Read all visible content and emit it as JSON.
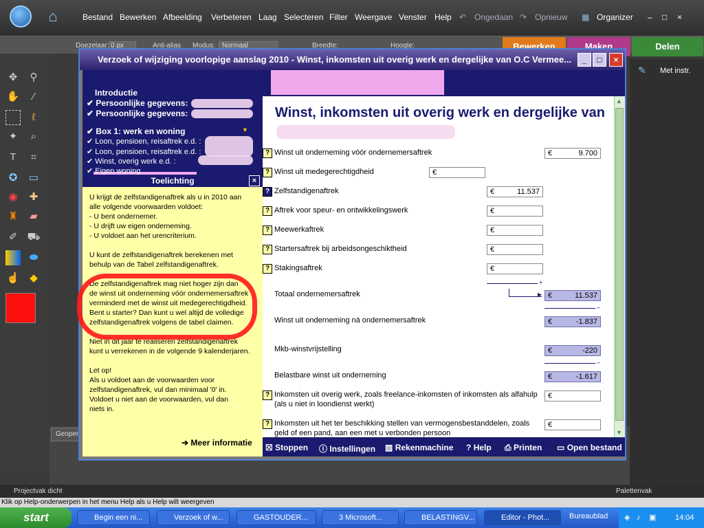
{
  "ps": {
    "menu": [
      "Bestand",
      "Bewerken",
      "Afbeelding",
      "Verbeteren",
      "Laag",
      "Selecteren",
      "Filter",
      "Weergave",
      "Venster",
      "Help"
    ],
    "undo": "Ongedaan",
    "redo": "Opnieuw",
    "organizer": "Organizer",
    "opt_doezelaar": "Doezelaar:",
    "opt_doezel_val": "0 px",
    "opt_antialias": "Anti-alias",
    "opt_modus": "Modus:",
    "opt_modus_val": "Normaal",
    "opt_breedte": "Breedte:",
    "opt_hoogte": "Hoogte:",
    "tab_bewerken": "Bewerken",
    "tab_maken": "Maken",
    "tab_delen": "Delen",
    "met_instr": "Met instr.",
    "geopend": "Geopen",
    "projectvak": "Projectvak dicht",
    "palettenvak": "Palettenvak",
    "helpline": "Klik op Help-onderwerpen in het menu Help als u Help wilt weergeven",
    "fg_color": "#ff1010"
  },
  "dialog": {
    "title": "Verzoek of wijziging voorlopige aanslag 2010 - Winst, inkomsten uit overig werk en dergelijke van O.C Vermee...",
    "nav": {
      "introductie": "Introductie",
      "pg1": "Persoonlijke gegevens:",
      "pg2": "Persoonlijke gegevens:",
      "box1": "Box 1: werk en woning",
      "loon1": "Loon, pensioen, reisaftrek e.d. :",
      "loon2": "Loon, pensioen, reisaftrek e.d. :",
      "winst": "Winst, overig werk e.d. :",
      "eigen": "Eigen woning"
    },
    "toelichting": {
      "header": "Toelichting",
      "p1": [
        "U krijgt de zelfstandigenaftrek als u in 2010 aan",
        "alle volgende voorwaarden voldoet:",
        "- U bent ondernemer.",
        "- U drijft uw eigen onderneming.",
        "- U voldoet aan het urencriterium."
      ],
      "p2": [
        "U kunt de zelfstandigenaftrek berekenen met",
        "behulp van de Tabel zelfstandigenaftrek."
      ],
      "p3": [
        "De zelfstandigenaftrek mag niet hoger zijn dan",
        "de winst uit onderneming vóór ondernemersaftrek",
        "verminderd met de winst uit medegerechtigdheid.",
        "Bent u starter? Dan kunt u wel altijd de volledige",
        "zelfstandigenaftrek volgens de tabel claimen."
      ],
      "p4": [
        "Niet in dit jaar te realiseren zelfstandigenaftrek",
        "kunt u verrekenen in de volgende 9 kalenderjaren."
      ],
      "p5": [
        "Let op!",
        "Als u voldoet aan de voorwaarden voor",
        "zelfstandigenaftrek, vul dan minimaal '0' in.",
        "Voldoet u niet aan de voorwaarden, vul dan",
        "niets in."
      ],
      "meer": "Meer informatie"
    },
    "form": {
      "title": "Winst, inkomsten uit overig werk en dergelijke van",
      "currency": "€",
      "rows": [
        {
          "label": "Winst uit onderneming vóór ondernemersaftrek",
          "value": "9.700"
        },
        {
          "label": "Winst uit medegerechtigdheid",
          "value": ""
        },
        {
          "label": "Zelfstandigenaftrek",
          "value": "11.537"
        },
        {
          "label": "Aftrek voor speur- en ontwikkelingswerk",
          "value": ""
        },
        {
          "label": "Meewerkaftrek",
          "value": ""
        },
        {
          "label": "Startersaftrek bij arbeidsongeschiktheid",
          "value": ""
        },
        {
          "label": "Stakingsaftrek",
          "value": ""
        },
        {
          "label": "Totaal ondernemersaftrek",
          "value": "11.537"
        },
        {
          "label": "Winst uit onderneming ná ondernemersaftrek",
          "value": "-1.837"
        },
        {
          "label": "Mkb-winstvrijstelling",
          "value": "-220"
        },
        {
          "label": "Belastbare winst uit onderneming",
          "value": "-1.617"
        },
        {
          "label": "Inkomsten uit overig werk, zoals freelance-inkomsten of inkomsten als alfahulp",
          "label2": "(als u niet in loondienst werkt)",
          "value": ""
        },
        {
          "label": "Inkomsten uit het ter beschikking stellen van vermogensbestanddelen, zoals",
          "label2": "geld of een pand, aan een met u verbonden persoon",
          "value": ""
        }
      ]
    },
    "buttons": {
      "stoppen": "Stoppen",
      "instellingen": "Instellingen",
      "rekenmachine": "Rekenmachine",
      "help": "Help",
      "printen": "Printen",
      "open": "Open bestand"
    }
  },
  "taskbar": {
    "start": "start",
    "tasks": [
      "Begin een ni...",
      "Verzoek of w...",
      "GASTOUDER...",
      "3 Microsoft...",
      "BELASTINGV...",
      "Editor - Phot..."
    ],
    "bureaublad": "Bureaublad",
    "clock": "14:04"
  }
}
